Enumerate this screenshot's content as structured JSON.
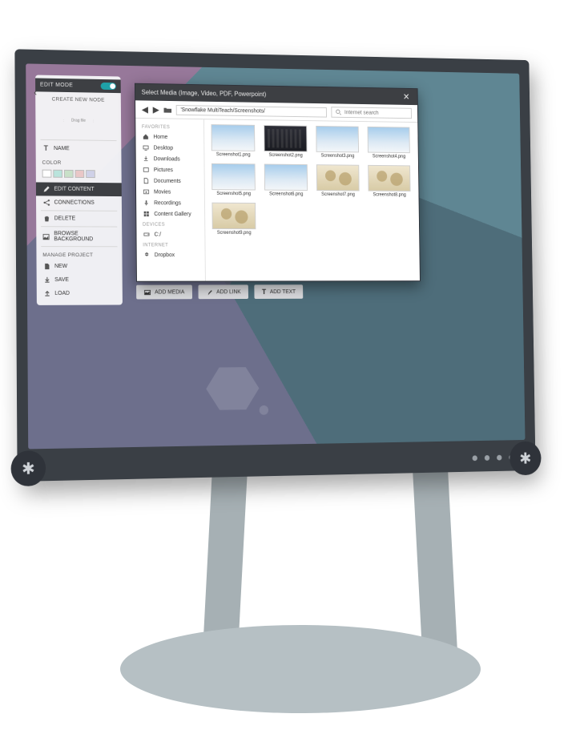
{
  "panel": {
    "edit_mode": "EDIT MODE",
    "create_title": "CREATE NEW NODE",
    "drop_hint": "Drag file",
    "name_label": "NAME",
    "color_label": "COLOR",
    "swatches": [
      "#ffffff",
      "#b9e3dc",
      "#c8e0c8",
      "#e9c7c7",
      "#cfd1e8"
    ],
    "edit_content": "EDIT CONTENT",
    "connections": "CONNECTIONS",
    "delete": "DELETE",
    "browse_bg": "BROWSE BACKGROUND",
    "manage_title": "MANAGE PROJECT",
    "new": "NEW",
    "save": "SAVE",
    "load": "LOAD"
  },
  "toolbar": {
    "add_media": "ADD MEDIA",
    "add_link": "ADD LINK",
    "add_text": "ADD TEXT"
  },
  "dialog": {
    "title": "Select Media (Image, Video, PDF, Powerpoint)",
    "path": "'Snowflake MultiTeach/Screenshots/",
    "search_placeholder": "Internet search",
    "sections": {
      "favorites": "FAVORITES",
      "devices": "DEVICES",
      "internet": "INTERNET"
    },
    "side": {
      "home": "Home",
      "desktop": "Desktop",
      "downloads": "Downloads",
      "pictures": "Pictures",
      "documents": "Documents",
      "movies": "Movies",
      "recordings": "Recordings",
      "gallery": "Content Gallery",
      "drive_c": "C:/",
      "dropbox": "Dropbox"
    },
    "files": [
      {
        "name": "Screenshot1.png",
        "kind": "sky"
      },
      {
        "name": "Screenshot2.png",
        "kind": "dark"
      },
      {
        "name": "Screenshot3.png",
        "kind": "sky"
      },
      {
        "name": "Screenshot4.png",
        "kind": "sky"
      },
      {
        "name": "Screenshot5.png",
        "kind": "sky"
      },
      {
        "name": "Screenshot6.png",
        "kind": "sky"
      },
      {
        "name": "Screenshot7.png",
        "kind": "map"
      },
      {
        "name": "Screenshot8.png",
        "kind": "map"
      },
      {
        "name": "Screenshot9.png",
        "kind": "map"
      }
    ]
  }
}
